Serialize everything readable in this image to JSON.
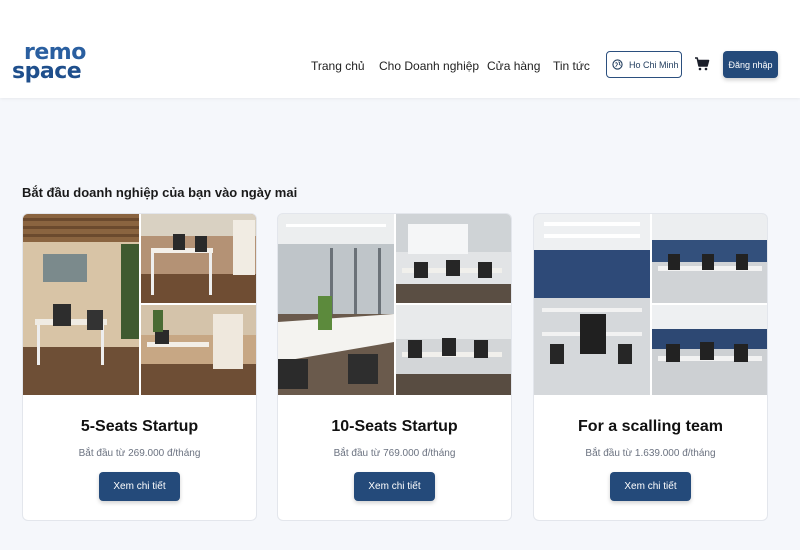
{
  "header": {
    "logo": {
      "line1": "remo",
      "line2": "space"
    },
    "nav": [
      {
        "label": "Trang chủ"
      },
      {
        "label": "Cho Doanh nghiệp"
      },
      {
        "label": "Cửa hàng"
      },
      {
        "label": "Tin tức"
      }
    ],
    "city_label": "Ho Chi Minh",
    "login_label": "Đăng nhập"
  },
  "section": {
    "title": "Bắt đầu doanh nghiệp của bạn vào ngày mai"
  },
  "cards": [
    {
      "name": "5-Seats Startup",
      "price": "Bắt đầu từ 269.000 đ/tháng",
      "button": "Xem chi tiết"
    },
    {
      "name": "10-Seats Startup",
      "price": "Bắt đầu từ 769.000 đ/tháng",
      "button": "Xem chi tiết"
    },
    {
      "name": "For a scalling team",
      "price": "Bắt đầu từ 1.639.000 đ/tháng",
      "button": "Xem chi tiết"
    }
  ],
  "colors": {
    "primary": "#244a7a",
    "logo": "#2a5fa0",
    "background": "#f5f7fb"
  }
}
